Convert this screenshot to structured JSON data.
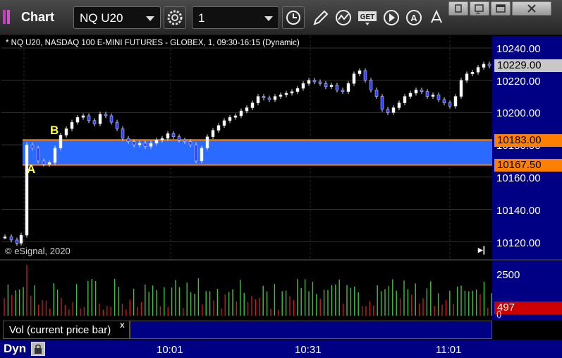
{
  "window": {
    "title": "Chart"
  },
  "toolbar": {
    "symbol": "NQ U20",
    "interval": "1",
    "icons": [
      "gear-icon",
      "clock-icon",
      "pencil-icon",
      "indicator-icon",
      "get-icon",
      "play-icon",
      "alert-icon",
      "cursor-icon"
    ]
  },
  "chart": {
    "header": "* NQ U20, NASDAQ 100 E-MINI FUTURES - GLOBEX, 1, 09:30-16:15 (Dynamic)",
    "copyright": "© eSignal, 2020",
    "letters": {
      "a": "A",
      "b": "B"
    },
    "price_ticks": [
      "10240.00",
      "10220.00",
      "10200.00",
      "10180.00",
      "10160.00",
      "10140.00",
      "10120.00"
    ],
    "last_price": "10229.00",
    "level_upper": "10183.00",
    "level_lower": "10167.50",
    "volume_tick": "2500",
    "last_volume": "497",
    "small_tick": "()",
    "time_ticks": [
      "10:01",
      "10:31",
      "11:01"
    ],
    "study_label": "Vol (current price bar)",
    "study_close": "x",
    "mode": "Dyn"
  },
  "colors": {
    "band": "#2a6aff",
    "level_line": "#ff8000",
    "axis_bg": "#000084",
    "up_volume": "#40c040",
    "down_volume": "#c02020",
    "last_price_tag": "#c8c8c8",
    "volume_tag": "#cc0000"
  },
  "chart_data": {
    "type": "candlestick",
    "ylim": [
      10115,
      10245
    ],
    "levels": [
      10183.0,
      10167.5
    ]
  }
}
